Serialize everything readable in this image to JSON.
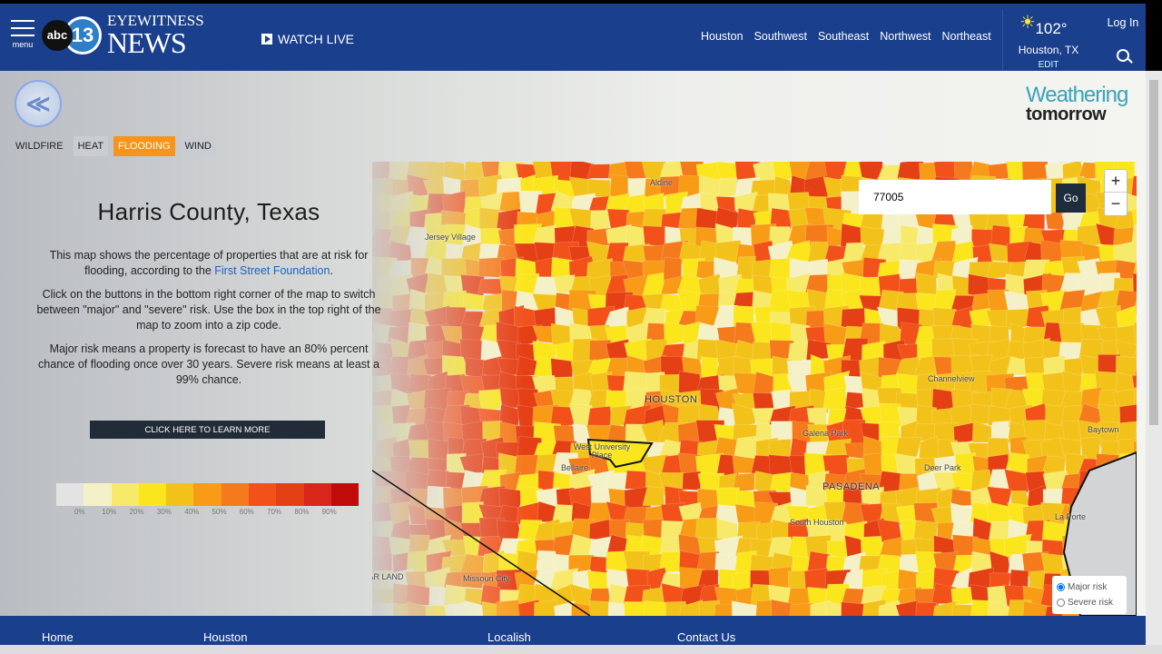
{
  "header": {
    "menu_label": "menu",
    "logo_abc": "abc",
    "logo_13": "13",
    "logo_line1": "EYEWITNESS",
    "logo_line2": "NEWS",
    "watch_live": "WATCH LIVE",
    "nav": [
      "Houston",
      "Southwest",
      "Southeast",
      "Northwest",
      "Northeast"
    ],
    "weather": {
      "temp": "102°",
      "location": "Houston, TX",
      "edit": "EDIT",
      "icon": "sun-cloud-icon"
    },
    "login": "Log In"
  },
  "tabs": [
    {
      "label": "WILDFIRE",
      "active": false
    },
    {
      "label": "HEAT",
      "active": false
    },
    {
      "label": "FLOODING",
      "active": true
    },
    {
      "label": "WIND",
      "active": false
    }
  ],
  "brand": {
    "line1": "Weathering",
    "line2": "tomorrow"
  },
  "panel": {
    "title": "Harris County, Texas",
    "p1_pre": "This map shows the percentage of properties that are at risk for flooding, according to the ",
    "p1_link": "First Street Foundation",
    "p1_post": ".",
    "p2": "Click on the buttons in the bottom right corner of the map to switch between \"major\" and \"severe\" risk. Use the box in the top right of the map to zoom into a zip code.",
    "p3": "Major risk means a property is forecast to have an 80% percent chance of flooding once over 30 years. Severe risk means at least a 99% chance.",
    "learn_more": "CLICK HERE TO LEARN MORE"
  },
  "legend": {
    "colors": [
      "#e3e3e3",
      "#f4f1c8",
      "#f7ea6a",
      "#fbe61e",
      "#f3c21a",
      "#f89b17",
      "#f57a1b",
      "#f2521a",
      "#e53f15",
      "#d8261a",
      "#c10b0b"
    ],
    "labels": [
      "0%",
      "10%",
      "20%",
      "30%",
      "40%",
      "50%",
      "60%",
      "70%",
      "80%",
      "90%"
    ]
  },
  "map": {
    "zip_value": "77005",
    "go": "Go",
    "zoom_in": "+",
    "zoom_out": "−",
    "places": [
      {
        "name": "Aldine"
      },
      {
        "name": "Jersey Village"
      },
      {
        "name": "HOUSTON"
      },
      {
        "name": "West University Place"
      },
      {
        "name": "Bellaire"
      },
      {
        "name": "Channelview"
      },
      {
        "name": "Galena Park"
      },
      {
        "name": "Deer Park"
      },
      {
        "name": "PASADENA"
      },
      {
        "name": "Baytown"
      },
      {
        "name": "South Houston"
      },
      {
        "name": "La Porte"
      },
      {
        "name": "Missouri City"
      },
      {
        "name": "SUGAR LAND"
      }
    ],
    "risk_options": [
      {
        "label": "Major risk",
        "checked": true
      },
      {
        "label": "Severe risk",
        "checked": false
      }
    ]
  },
  "footer": {
    "links": [
      "Home",
      "Houston",
      "Localish",
      "Contact Us"
    ]
  }
}
